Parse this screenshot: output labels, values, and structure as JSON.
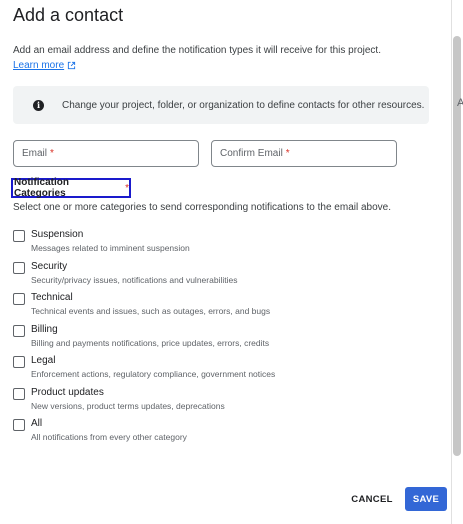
{
  "dialog": {
    "title": "Add a contact",
    "description": "Add an email address and define the notification types it will receive for this project.",
    "learn_more": "Learn more",
    "info_text": "Change your project, folder, or organization to define contacts for other resources."
  },
  "fields": {
    "email_placeholder": "Email",
    "confirm_placeholder": "Confirm Email",
    "required_mark": "*"
  },
  "categories_section": {
    "heading": "Notification Categories",
    "required_mark": "*",
    "description": "Select one or more categories to send corresponding notifications to the email above."
  },
  "categories": [
    {
      "label": "Suspension",
      "sub": "Messages related to imminent suspension",
      "checked": false
    },
    {
      "label": "Security",
      "sub": "Security/privacy issues, notifications and vulnerabilities",
      "checked": false
    },
    {
      "label": "Technical",
      "sub": "Technical events and issues, such as outages, errors, and bugs",
      "checked": false
    },
    {
      "label": "Billing",
      "sub": "Billing and payments notifications, price updates, errors, credits",
      "checked": false
    },
    {
      "label": "Legal",
      "sub": "Enforcement actions, regulatory compliance, government notices",
      "checked": false
    },
    {
      "label": "Product updates",
      "sub": "New versions, product terms updates, deprecations",
      "checked": false
    },
    {
      "label": "All",
      "sub": "All notifications from every other category",
      "checked": false
    }
  ],
  "actions": {
    "cancel": "CANCEL",
    "save": "SAVE"
  },
  "edge_text": "A",
  "colors": {
    "accent": "#1a73e8",
    "primary_button": "#3367d6",
    "required": "#d93025",
    "focus_outline": "#1a1acc"
  }
}
